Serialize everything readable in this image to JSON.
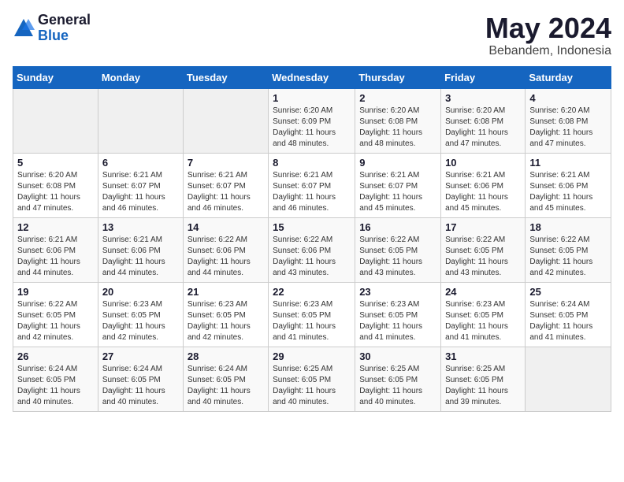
{
  "header": {
    "logo_general": "General",
    "logo_blue": "Blue",
    "month_year": "May 2024",
    "location": "Bebandem, Indonesia"
  },
  "weekdays": [
    "Sunday",
    "Monday",
    "Tuesday",
    "Wednesday",
    "Thursday",
    "Friday",
    "Saturday"
  ],
  "weeks": [
    [
      {
        "day": "",
        "empty": true
      },
      {
        "day": "",
        "empty": true
      },
      {
        "day": "",
        "empty": true
      },
      {
        "day": "1",
        "sunrise": "6:20 AM",
        "sunset": "6:09 PM",
        "daylight": "11 hours and 48 minutes."
      },
      {
        "day": "2",
        "sunrise": "6:20 AM",
        "sunset": "6:08 PM",
        "daylight": "11 hours and 48 minutes."
      },
      {
        "day": "3",
        "sunrise": "6:20 AM",
        "sunset": "6:08 PM",
        "daylight": "11 hours and 47 minutes."
      },
      {
        "day": "4",
        "sunrise": "6:20 AM",
        "sunset": "6:08 PM",
        "daylight": "11 hours and 47 minutes."
      }
    ],
    [
      {
        "day": "5",
        "sunrise": "6:20 AM",
        "sunset": "6:08 PM",
        "daylight": "11 hours and 47 minutes."
      },
      {
        "day": "6",
        "sunrise": "6:21 AM",
        "sunset": "6:07 PM",
        "daylight": "11 hours and 46 minutes."
      },
      {
        "day": "7",
        "sunrise": "6:21 AM",
        "sunset": "6:07 PM",
        "daylight": "11 hours and 46 minutes."
      },
      {
        "day": "8",
        "sunrise": "6:21 AM",
        "sunset": "6:07 PM",
        "daylight": "11 hours and 46 minutes."
      },
      {
        "day": "9",
        "sunrise": "6:21 AM",
        "sunset": "6:07 PM",
        "daylight": "11 hours and 45 minutes."
      },
      {
        "day": "10",
        "sunrise": "6:21 AM",
        "sunset": "6:06 PM",
        "daylight": "11 hours and 45 minutes."
      },
      {
        "day": "11",
        "sunrise": "6:21 AM",
        "sunset": "6:06 PM",
        "daylight": "11 hours and 45 minutes."
      }
    ],
    [
      {
        "day": "12",
        "sunrise": "6:21 AM",
        "sunset": "6:06 PM",
        "daylight": "11 hours and 44 minutes."
      },
      {
        "day": "13",
        "sunrise": "6:21 AM",
        "sunset": "6:06 PM",
        "daylight": "11 hours and 44 minutes."
      },
      {
        "day": "14",
        "sunrise": "6:22 AM",
        "sunset": "6:06 PM",
        "daylight": "11 hours and 44 minutes."
      },
      {
        "day": "15",
        "sunrise": "6:22 AM",
        "sunset": "6:06 PM",
        "daylight": "11 hours and 43 minutes."
      },
      {
        "day": "16",
        "sunrise": "6:22 AM",
        "sunset": "6:05 PM",
        "daylight": "11 hours and 43 minutes."
      },
      {
        "day": "17",
        "sunrise": "6:22 AM",
        "sunset": "6:05 PM",
        "daylight": "11 hours and 43 minutes."
      },
      {
        "day": "18",
        "sunrise": "6:22 AM",
        "sunset": "6:05 PM",
        "daylight": "11 hours and 42 minutes."
      }
    ],
    [
      {
        "day": "19",
        "sunrise": "6:22 AM",
        "sunset": "6:05 PM",
        "daylight": "11 hours and 42 minutes."
      },
      {
        "day": "20",
        "sunrise": "6:23 AM",
        "sunset": "6:05 PM",
        "daylight": "11 hours and 42 minutes."
      },
      {
        "day": "21",
        "sunrise": "6:23 AM",
        "sunset": "6:05 PM",
        "daylight": "11 hours and 42 minutes."
      },
      {
        "day": "22",
        "sunrise": "6:23 AM",
        "sunset": "6:05 PM",
        "daylight": "11 hours and 41 minutes."
      },
      {
        "day": "23",
        "sunrise": "6:23 AM",
        "sunset": "6:05 PM",
        "daylight": "11 hours and 41 minutes."
      },
      {
        "day": "24",
        "sunrise": "6:23 AM",
        "sunset": "6:05 PM",
        "daylight": "11 hours and 41 minutes."
      },
      {
        "day": "25",
        "sunrise": "6:24 AM",
        "sunset": "6:05 PM",
        "daylight": "11 hours and 41 minutes."
      }
    ],
    [
      {
        "day": "26",
        "sunrise": "6:24 AM",
        "sunset": "6:05 PM",
        "daylight": "11 hours and 40 minutes."
      },
      {
        "day": "27",
        "sunrise": "6:24 AM",
        "sunset": "6:05 PM",
        "daylight": "11 hours and 40 minutes."
      },
      {
        "day": "28",
        "sunrise": "6:24 AM",
        "sunset": "6:05 PM",
        "daylight": "11 hours and 40 minutes."
      },
      {
        "day": "29",
        "sunrise": "6:25 AM",
        "sunset": "6:05 PM",
        "daylight": "11 hours and 40 minutes."
      },
      {
        "day": "30",
        "sunrise": "6:25 AM",
        "sunset": "6:05 PM",
        "daylight": "11 hours and 40 minutes."
      },
      {
        "day": "31",
        "sunrise": "6:25 AM",
        "sunset": "6:05 PM",
        "daylight": "11 hours and 39 minutes."
      },
      {
        "day": "",
        "empty": true
      }
    ]
  ]
}
